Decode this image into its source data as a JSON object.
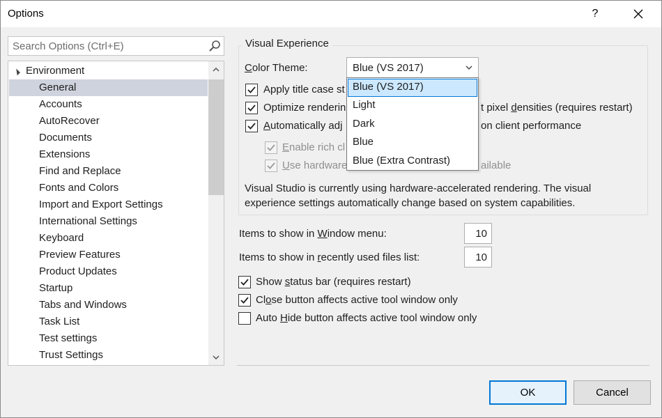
{
  "window": {
    "title": "Options",
    "help_glyph": "?"
  },
  "search": {
    "placeholder": "Search Options (Ctrl+E)"
  },
  "tree": {
    "root": "Environment",
    "selected_index": 0,
    "items": [
      "General",
      "Accounts",
      "AutoRecover",
      "Documents",
      "Extensions",
      "Find and Replace",
      "Fonts and Colors",
      "Import and Export Settings",
      "International Settings",
      "Keyboard",
      "Preview Features",
      "Product Updates",
      "Startup",
      "Tabs and Windows",
      "Task List",
      "Test settings",
      "Trust Settings"
    ]
  },
  "visual_experience": {
    "group_title": "Visual Experience",
    "color_theme": {
      "label_before": "",
      "label_ul": "C",
      "label_after": "olor Theme:",
      "value": "Blue (VS 2017)"
    },
    "checkbox1": {
      "label": "Apply title case st",
      "checked": true
    },
    "checkbox2": {
      "label_a": "Optimize renderin",
      "label_b_before": "t pixel ",
      "label_b_ul": "d",
      "label_b_after": "ensities (requires restart)",
      "checked": true
    },
    "checkbox3": {
      "label_a_ul": "A",
      "label_a_after": "utomatically adj",
      "label_b": "on client performance",
      "checked": true
    },
    "checkbox4": {
      "label_ul": "E",
      "label_after": "nable rich cl",
      "checked": true,
      "disabled": true
    },
    "checkbox5": {
      "label_ul": "U",
      "label_after": "se hardware",
      "label_b": "ailable",
      "checked": true,
      "disabled": true
    },
    "info": "Visual Studio is currently using hardware-accelerated rendering. The visual experience settings automatically change based on system capabilities."
  },
  "window_menu": {
    "label_before": "Items to show in ",
    "label_ul": "W",
    "label_after": "indow menu:",
    "value": "10"
  },
  "recent_files": {
    "label_before": "Items to show in ",
    "label_ul": "r",
    "label_after": "ecently used files list:",
    "value": "10"
  },
  "options": {
    "status_bar": {
      "label_before": "Show ",
      "label_ul": "s",
      "label_after": "tatus bar (requires restart)",
      "checked": true
    },
    "close_button": {
      "label_before": "Cl",
      "label_ul": "o",
      "label_after": "se button affects active tool window only",
      "checked": true
    },
    "auto_hide": {
      "label_before": "Auto ",
      "label_ul": "H",
      "label_after": "ide button affects active tool window only",
      "checked": false
    }
  },
  "dropdown": {
    "items": [
      "Blue (VS 2017)",
      "Light",
      "Dark",
      "Blue",
      "Blue (Extra Contrast)"
    ],
    "selected_index": 0
  },
  "buttons": {
    "ok": "OK",
    "cancel": "Cancel"
  },
  "colors": {
    "accent": "#0078d7",
    "selection": "#cfd3dd",
    "dropdown_selection": "#cce8ff"
  }
}
